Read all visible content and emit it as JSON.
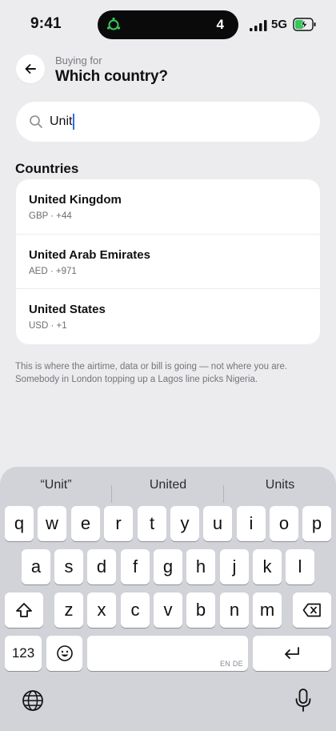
{
  "status_bar": {
    "time": "9:41",
    "activity_count": "4",
    "network": "5G",
    "activity_icon_color": "#34c759",
    "battery_color": "#34c759"
  },
  "header": {
    "eyebrow": "Buying for",
    "title": "Which country?",
    "back_icon": "arrow-left-icon"
  },
  "search": {
    "value": "Unit",
    "icon": "search-icon"
  },
  "section": {
    "title": "Countries",
    "items": [
      {
        "name": "United Kingdom",
        "meta": "GBP · +44"
      },
      {
        "name": "United Arab Emirates",
        "meta": "AED · +971"
      },
      {
        "name": "United States",
        "meta": "USD · +1"
      }
    ]
  },
  "helper_text": "This is where the airtime, data or bill is going — not where you are. Somebody in London topping up a Lagos line picks Nigeria.",
  "keyboard": {
    "suggestions": [
      "“Unit”",
      "United",
      "Units"
    ],
    "rows": [
      [
        "q",
        "w",
        "e",
        "r",
        "t",
        "y",
        "u",
        "i",
        "o",
        "p"
      ],
      [
        "a",
        "s",
        "d",
        "f",
        "g",
        "h",
        "j",
        "k",
        "l"
      ],
      [
        "z",
        "x",
        "c",
        "v",
        "b",
        "n",
        "m"
      ]
    ],
    "numbers_label": "123",
    "space_lang": "EN DE"
  },
  "colors": {
    "background": "#ececef",
    "card": "#ffffff",
    "caret": "#2f6fea",
    "keyboard": "#d1d3d9"
  }
}
